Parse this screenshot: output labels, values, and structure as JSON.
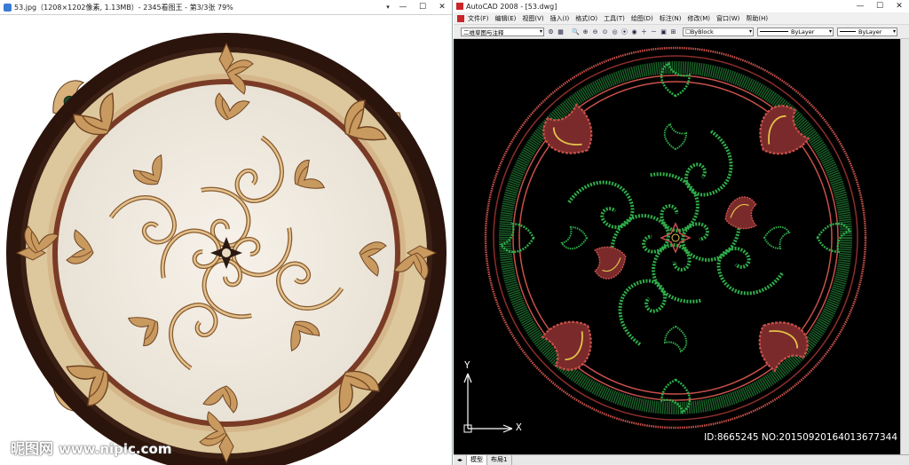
{
  "viewer": {
    "title": "53.jpg（1208×1202像素, 1.13MB）- 2345看图王 - 第3/3张 79%",
    "watermark": "昵图网",
    "watermark_url": "www.nipic.com"
  },
  "cad": {
    "title": "AutoCAD 2008 - [53.dwg]",
    "menu": [
      "文件(F)",
      "编辑(E)",
      "视图(V)",
      "插入(I)",
      "格式(O)",
      "工具(T)",
      "绘图(D)",
      "标注(N)",
      "修改(M)",
      "窗口(W)",
      "帮助(H)"
    ],
    "workspace": "二维草图与注释",
    "layer": "ByBlock",
    "linetype": "ByLayer",
    "lineweight": "ByLayer",
    "tabs": [
      "模型",
      "布局1"
    ],
    "ucs_x": "X",
    "ucs_y": "Y",
    "id_text": "ID:8665245 NO:20150920164013677344"
  },
  "colors": {
    "cad_bg": "#000000",
    "cad_red": "#c8514a",
    "cad_green": "#2fae4a",
    "marble_brown": "#2b140c",
    "marble_gold": "#c9a06a",
    "marble_cream": "#efe1c4"
  }
}
